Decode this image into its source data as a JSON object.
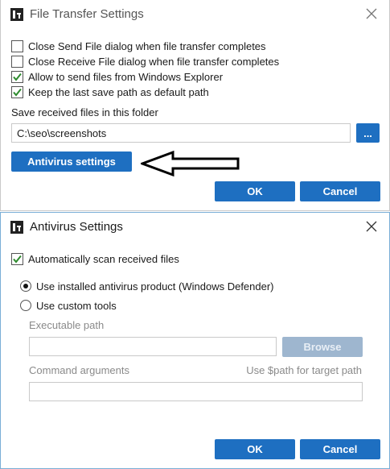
{
  "dialog1": {
    "title": "File Transfer Settings",
    "checkboxes": [
      {
        "label": "Close Send File dialog when file transfer completes",
        "checked": false
      },
      {
        "label": "Close Receive File dialog when file transfer completes",
        "checked": false
      },
      {
        "label": "Allow to send files from Windows Explorer",
        "checked": true
      },
      {
        "label": "Keep the last save path as default path",
        "checked": true
      }
    ],
    "folder_label": "Save received files in this folder",
    "folder_value": "C:\\seo\\screenshots",
    "browse_label": "...",
    "antivirus_button": "Antivirus settings",
    "ok_label": "OK",
    "cancel_label": "Cancel"
  },
  "dialog2": {
    "title": "Antivirus Settings",
    "auto_scan": {
      "label": "Automatically scan received files",
      "checked": true
    },
    "radios": [
      {
        "label": "Use installed antivirus product (Windows Defender)",
        "selected": true
      },
      {
        "label": "Use custom tools",
        "selected": false
      }
    ],
    "exe_label": "Executable path",
    "exe_value": "",
    "browse_label": "Browse",
    "cmd_label": "Command arguments",
    "cmd_hint": "Use $path for target path",
    "cmd_value": "",
    "ok_label": "OK",
    "cancel_label": "Cancel"
  },
  "colors": {
    "accent": "#1e6fc1",
    "check": "#2e8b2e",
    "disabled_button": "#9eb6cf"
  },
  "icons": [
    "app-icon",
    "close-icon",
    "checkmark-icon",
    "radio-dot-icon",
    "arrow-left-icon"
  ]
}
